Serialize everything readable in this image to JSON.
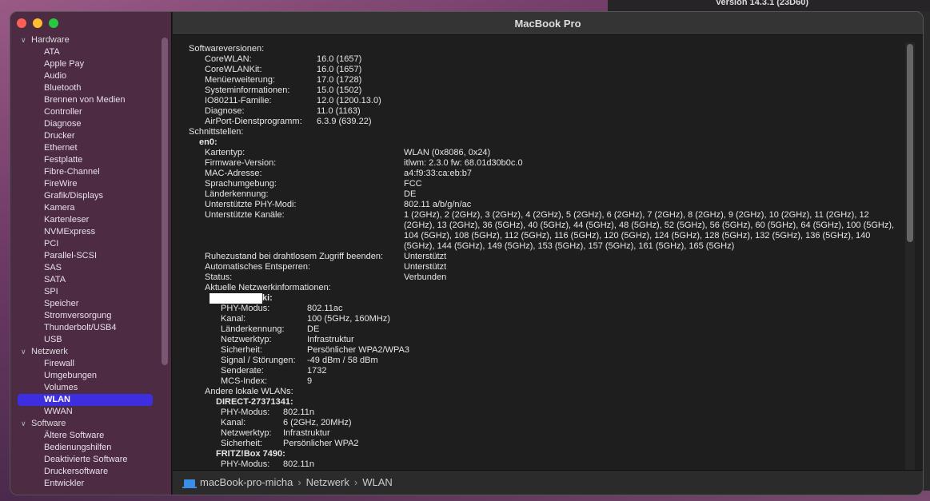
{
  "background_window": {
    "version": "Version 14.3.1 (23D60)"
  },
  "window": {
    "title": "MacBook Pro"
  },
  "sidebar": [
    {
      "category": "Hardware",
      "items": [
        "ATA",
        "Apple Pay",
        "Audio",
        "Bluetooth",
        "Brennen von Medien",
        "Controller",
        "Diagnose",
        "Drucker",
        "Ethernet",
        "Festplatte",
        "Fibre-Channel",
        "FireWire",
        "Grafik/Displays",
        "Kamera",
        "Kartenleser",
        "NVMExpress",
        "PCI",
        "Parallel-SCSI",
        "SAS",
        "SATA",
        "SPI",
        "Speicher",
        "Stromversorgung",
        "Thunderbolt/USB4",
        "USB"
      ]
    },
    {
      "category": "Netzwerk",
      "items": [
        "Firewall",
        "Umgebungen",
        "Volumes",
        "WLAN",
        "WWAN"
      ]
    },
    {
      "category": "Software",
      "items": [
        "Ältere Software",
        "Bedienungshilfen",
        "Deaktivierte Software",
        "Druckersoftware",
        "Entwickler"
      ]
    }
  ],
  "selected_item": "WLAN",
  "content": {
    "software_versions": {
      "title": "Softwareversionen:",
      "items": [
        {
          "label": "CoreWLAN:",
          "value": "16.0 (1657)"
        },
        {
          "label": "CoreWLANKit:",
          "value": "16.0 (1657)"
        },
        {
          "label": "Menüerweiterung:",
          "value": "17.0 (1728)"
        },
        {
          "label": "Systeminformationen:",
          "value": "15.0 (1502)"
        },
        {
          "label": "IO80211-Familie:",
          "value": "12.0 (1200.13.0)"
        },
        {
          "label": "Diagnose:",
          "value": "11.0 (1163)"
        },
        {
          "label": "AirPort-Dienstprogramm:",
          "value": "6.3.9 (639.22)"
        }
      ]
    },
    "interfaces_title": "Schnittstellen:",
    "interface": {
      "name": "en0:",
      "items": [
        {
          "label": "Kartentyp:",
          "value": "WLAN  (0x8086, 0x24)"
        },
        {
          "label": "Firmware-Version:",
          "value": "itlwm: 2.3.0 fw: 68.01d30b0c.0"
        },
        {
          "label": "MAC-Adresse:",
          "value": "a4:f9:33:ca:eb:b7"
        },
        {
          "label": "Sprachumgebung:",
          "value": "FCC"
        },
        {
          "label": "Länderkennung:",
          "value": "DE"
        },
        {
          "label": "Unterstützte PHY-Modi:",
          "value": "802.11 a/b/g/n/ac"
        },
        {
          "label": "Unterstützte Kanäle:",
          "value": "1 (2GHz), 2 (2GHz), 3 (2GHz), 4 (2GHz), 5 (2GHz), 6 (2GHz), 7 (2GHz), 8 (2GHz), 9 (2GHz), 10 (2GHz), 11 (2GHz), 12 (2GHz), 13 (2GHz), 36 (5GHz), 40 (5GHz), 44 (5GHz), 48 (5GHz), 52 (5GHz), 56 (5GHz), 60 (5GHz), 64 (5GHz), 100 (5GHz), 104 (5GHz), 108 (5GHz), 112 (5GHz), 116 (5GHz), 120 (5GHz), 124 (5GHz), 128 (5GHz), 132 (5GHz), 136 (5GHz), 140 (5GHz), 144 (5GHz), 149 (5GHz), 153 (5GHz), 157 (5GHz), 161 (5GHz), 165 (5GHz)",
          "lines": 4
        },
        {
          "label": "Ruhezustand bei drahtlosem Zugriff beenden:",
          "value": "Unterstützt"
        },
        {
          "label": "Automatisches Entsperren:",
          "value": "Unterstützt"
        },
        {
          "label": "Status:",
          "value": "Verbunden"
        }
      ]
    },
    "current_network": {
      "title": "Aktuelle Netzwerkinformationen:",
      "name_visible": "ki:",
      "items": [
        {
          "label": "PHY-Modus:",
          "value": "802.11ac"
        },
        {
          "label": "Kanal:",
          "value": "100 (5GHz, 160MHz)"
        },
        {
          "label": "Länderkennung:",
          "value": "DE"
        },
        {
          "label": "Netzwerktyp:",
          "value": "Infrastruktur"
        },
        {
          "label": "Sicherheit:",
          "value": "Persönlicher WPA2/WPA3"
        },
        {
          "label": "Signal / Störungen:",
          "value": "-49 dBm / 58 dBm"
        },
        {
          "label": "Senderate:",
          "value": "1732"
        },
        {
          "label": "MCS-Index:",
          "value": "9"
        }
      ]
    },
    "other_networks": {
      "title": "Andere lokale WLANs:",
      "networks": [
        {
          "name": "DIRECT-27371341:",
          "items": [
            {
              "label": "PHY-Modus:",
              "value": "802.11n"
            },
            {
              "label": "Kanal:",
              "value": "6 (2GHz, 20MHz)"
            },
            {
              "label": "Netzwerktyp:",
              "value": "Infrastruktur"
            },
            {
              "label": "Sicherheit:",
              "value": "Persönlicher WPA2"
            }
          ]
        },
        {
          "name": "FRITZ!Box 7490:",
          "items": [
            {
              "label": "PHY-Modus:",
              "value": "802.11n"
            }
          ]
        }
      ]
    }
  },
  "breadcrumb": [
    "macBook-pro-micha",
    "Netzwerk",
    "WLAN"
  ]
}
